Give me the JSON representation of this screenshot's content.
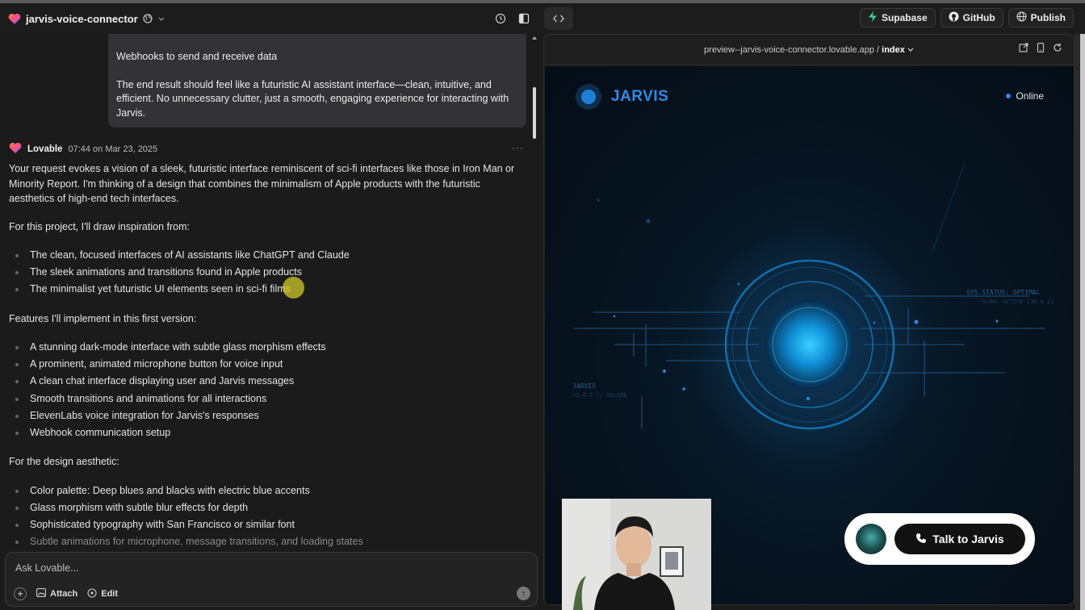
{
  "header": {
    "project_name": "jarvis-voice-connector",
    "supabase_label": "Supabase",
    "github_label": "GitHub",
    "publish_label": "Publish"
  },
  "chat": {
    "user_bubble": {
      "line1": "Webhooks to send and receive data",
      "line2": "The end result should feel like a futuristic AI assistant interface—clean, intuitive, and efficient. No unnecessary clutter, just a smooth, engaging experience for interacting with Jarvis."
    },
    "reply": {
      "author": "Lovable",
      "time": "07:44 on Mar 23, 2025",
      "intro": "Your request evokes a vision of a sleek, futuristic interface reminiscent of sci-fi interfaces like those in Iron Man or Minority Report. I'm thinking of a design that combines the minimalism of Apple products with the futuristic aesthetics of high-end tech interfaces.",
      "inspiration_heading": "For this project, I'll draw inspiration from:",
      "inspiration": [
        "The clean, focused interfaces of AI assistants like ChatGPT and Claude",
        "The sleek animations and transitions found in Apple products",
        "The minimalist yet futuristic UI elements seen in sci-fi films"
      ],
      "features_heading": "Features I'll implement in this first version:",
      "features": [
        "A stunning dark-mode interface with subtle glass morphism effects",
        "A prominent, animated microphone button for voice input",
        "A clean chat interface displaying user and Jarvis messages",
        "Smooth transitions and animations for all interactions",
        "ElevenLabs voice integration for Jarvis's responses",
        "Webhook communication setup"
      ],
      "design_heading": "For the design aesthetic:",
      "design": [
        "Color palette: Deep blues and blacks with electric blue accents",
        "Glass morphism with subtle blur effects for depth",
        "Sophisticated typography with San Francisco or similar font",
        "Subtle animations for microphone, message transitions, and loading states"
      ]
    },
    "input": {
      "placeholder": "Ask Lovable...",
      "attach_label": "Attach",
      "edit_label": "Edit"
    }
  },
  "preview": {
    "url_prefix": "preview--jarvis-voice-connector.lovable.app / ",
    "url_page": "index",
    "app": {
      "brand": "JARVIS",
      "status": "Online",
      "sys_status": "SYS.STATUS: OPTIMAL",
      "scan": "SCAN: ACTIVE [38.0.2]",
      "jarvis_tag": "JARVIS",
      "version": "v1.0.7 // ONLINE",
      "talk_label": "Talk to Jarvis"
    }
  },
  "colors": {
    "accent": "#2f8ae8",
    "supabase_green": "#3ecf8e"
  }
}
